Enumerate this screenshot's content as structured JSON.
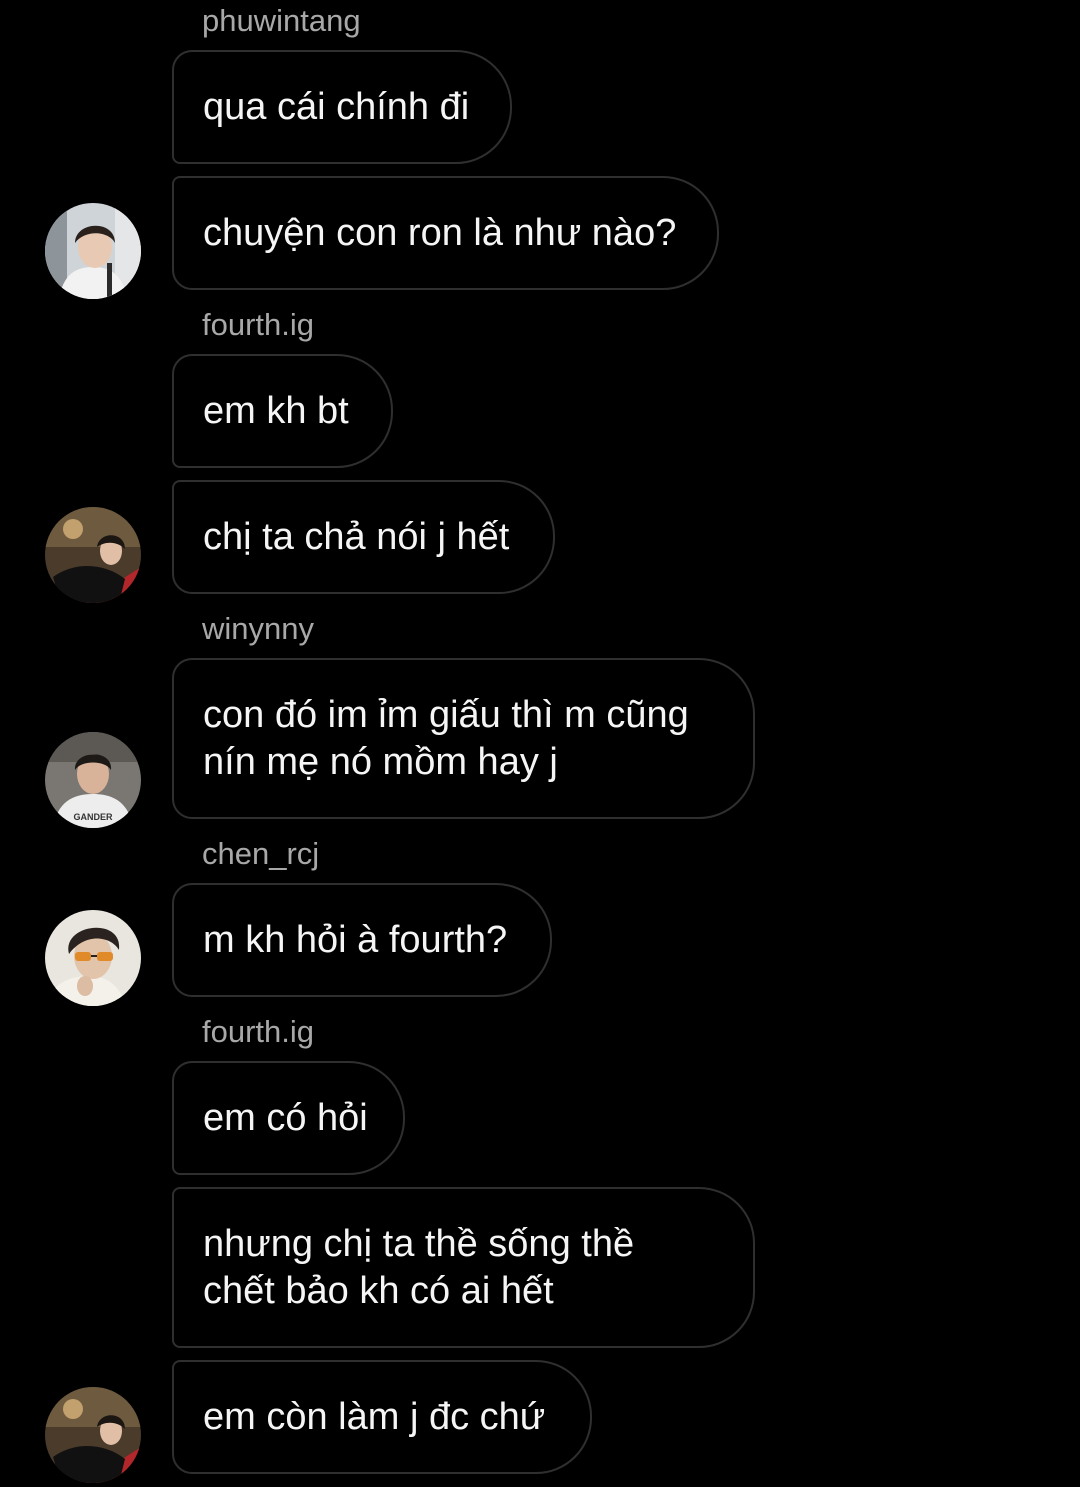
{
  "messages": [
    {
      "sender": "phuwintang",
      "text": "qua cái chính đi"
    },
    {
      "text": "chuyện con ron là như nào?"
    },
    {
      "sender": "fourth.ig",
      "text": "em kh bt"
    },
    {
      "text": "chị ta chả nói j hết"
    },
    {
      "sender": "winynny",
      "text": "con đó im ỉm giấu thì m cũng\nnín mẹ nó mồm hay j"
    },
    {
      "sender": "chen_rcj",
      "text": "m kh hỏi à fourth?"
    },
    {
      "sender": "fourth.ig",
      "text": "em có hỏi"
    },
    {
      "text": "nhưng chị ta thề sống thề\nchết bảo kh có ai hết"
    },
    {
      "text": "em còn làm j đc chứ"
    }
  ],
  "avatars": [
    {
      "user": "phuwintang"
    },
    {
      "user": "fourth.ig"
    },
    {
      "user": "winynny",
      "shirt_text": "GANDER"
    },
    {
      "user": "chen_rcj"
    },
    {
      "user": "fourth.ig"
    }
  ],
  "colors": {
    "background": "#000000",
    "bubble_border": "#2f2f2f",
    "message_text": "#f5f5f5",
    "sender_text": "#a8a8a8"
  }
}
